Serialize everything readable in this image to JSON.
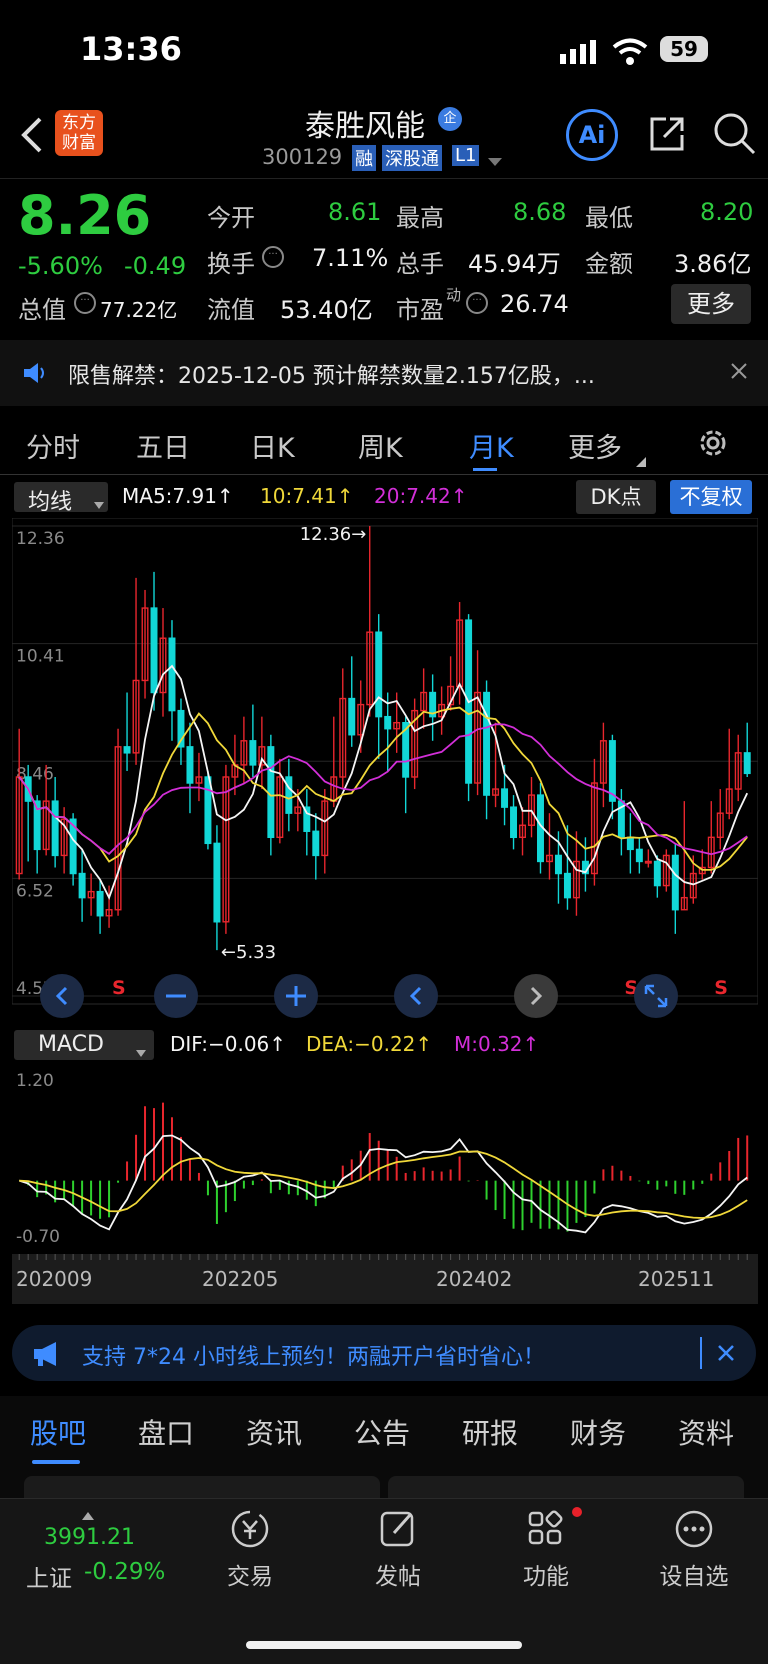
{
  "status_bar": {
    "time": "13:36",
    "battery": "59"
  },
  "header": {
    "logo_line1": "东方",
    "logo_line2": "财富",
    "stock_name": "泰胜风能",
    "badge": "企",
    "code": "300129",
    "tags": [
      "融",
      "深股通",
      "L1"
    ],
    "ai_label": "Ai"
  },
  "quote": {
    "price": "8.26",
    "change_pct": "-5.60%",
    "change_abs": "-0.49",
    "open_label": "今开",
    "open": "8.61",
    "high_label": "最高",
    "high": "8.68",
    "low_label": "最低",
    "low": "8.20",
    "turnover_label": "换手",
    "turnover": "7.11%",
    "volume_label": "总手",
    "volume": "45.94万",
    "amount_label": "金额",
    "amount": "3.86亿",
    "mktcap_label": "总值",
    "mktcap": "77.22亿",
    "float_label": "流值",
    "float": "53.40亿",
    "pe_label": "市盈",
    "pe_sup": "动",
    "pe": "26.74",
    "more_button": "更多"
  },
  "notice": {
    "text": "限售解禁：2025-12-05 预计解禁数量2.157亿股，..."
  },
  "chart_tabs": [
    "分时",
    "五日",
    "日K",
    "周K",
    "月K",
    "更多"
  ],
  "active_chart_tab": "月K",
  "ma_bar": {
    "selector": "均线",
    "ma5": "MA5:7.91↑",
    "ma10": "10:7.41↑",
    "ma20": "20:7.42↑",
    "dk_button": "DK点",
    "adjust_button": "不复权"
  },
  "macd_bar": {
    "selector": "MACD",
    "dif": "DIF:−0.06↑",
    "dea": "DEA:−0.22↑",
    "m": "M:0.32↑"
  },
  "chart_data": [
    {
      "type": "candlestick",
      "title": "月K",
      "y_ticks": [
        "12.36",
        "10.41",
        "8.46",
        "6.52",
        "4.57"
      ],
      "ylim": [
        4.57,
        12.36
      ],
      "annotations": {
        "max": "12.36→",
        "min": "←5.33"
      },
      "signals": [
        "S",
        "S",
        "S",
        "S"
      ],
      "x_labels": [
        "202009",
        "202205",
        "202402",
        "202511"
      ],
      "candles": [
        [
          6.6,
          8.2,
          9.0,
          6.5
        ],
        [
          8.2,
          7.8,
          8.4,
          6.8
        ],
        [
          7.8,
          7.0,
          7.9,
          6.6
        ],
        [
          7.0,
          7.8,
          8.4,
          6.9
        ],
        [
          7.8,
          6.9,
          8.2,
          6.7
        ],
        [
          6.9,
          7.5,
          7.7,
          6.6
        ],
        [
          7.5,
          6.6,
          7.6,
          6.4
        ],
        [
          6.6,
          6.2,
          7.0,
          5.8
        ],
        [
          6.2,
          6.3,
          6.6,
          5.9
        ],
        [
          6.3,
          5.9,
          6.5,
          5.6
        ],
        [
          5.9,
          6.0,
          6.4,
          5.7
        ],
        [
          6.0,
          8.7,
          9.0,
          5.9
        ],
        [
          8.7,
          8.6,
          9.6,
          8.3
        ],
        [
          8.6,
          9.8,
          11.5,
          8.4
        ],
        [
          9.8,
          11.0,
          11.3,
          9.5
        ],
        [
          11.0,
          9.6,
          11.6,
          9.3
        ],
        [
          9.6,
          10.5,
          11.0,
          9.2
        ],
        [
          10.5,
          9.3,
          10.8,
          8.8
        ],
        [
          9.3,
          8.7,
          9.5,
          8.4
        ],
        [
          8.7,
          8.1,
          9.1,
          7.6
        ],
        [
          8.1,
          8.2,
          8.6,
          7.8
        ],
        [
          8.2,
          7.1,
          8.3,
          7.0
        ],
        [
          7.1,
          5.8,
          7.4,
          5.33
        ],
        [
          5.8,
          8.2,
          8.4,
          5.6
        ],
        [
          8.2,
          8.4,
          8.9,
          7.9
        ],
        [
          8.4,
          8.8,
          9.2,
          8.1
        ],
        [
          8.8,
          8.4,
          9.4,
          8.2
        ],
        [
          8.4,
          8.7,
          9.2,
          8.0
        ],
        [
          8.7,
          7.2,
          8.9,
          6.9
        ],
        [
          7.2,
          8.2,
          8.5,
          7.1
        ],
        [
          8.2,
          7.6,
          8.5,
          7.3
        ],
        [
          7.6,
          7.7,
          8.0,
          7.3
        ],
        [
          7.7,
          7.3,
          8.0,
          6.9
        ],
        [
          7.3,
          6.9,
          7.6,
          6.5
        ],
        [
          6.9,
          7.8,
          8.0,
          6.6
        ],
        [
          7.8,
          8.2,
          9.2,
          7.7
        ],
        [
          8.2,
          9.5,
          10.0,
          8.0
        ],
        [
          9.5,
          8.9,
          10.2,
          8.7
        ],
        [
          8.9,
          9.4,
          9.8,
          8.6
        ],
        [
          9.4,
          10.6,
          12.36,
          9.2
        ],
        [
          10.6,
          9.2,
          10.9,
          8.5
        ],
        [
          9.2,
          9.0,
          9.6,
          8.3
        ],
        [
          9.0,
          9.1,
          9.6,
          8.6
        ],
        [
          9.1,
          8.2,
          9.2,
          7.6
        ],
        [
          8.2,
          9.3,
          9.5,
          8.0
        ],
        [
          9.3,
          9.6,
          10.0,
          9.0
        ],
        [
          9.6,
          9.2,
          9.9,
          8.8
        ],
        [
          9.2,
          9.4,
          9.7,
          8.9
        ],
        [
          9.4,
          9.7,
          10.2,
          9.3
        ],
        [
          9.7,
          10.8,
          11.1,
          9.4
        ],
        [
          10.8,
          8.1,
          10.9,
          7.8
        ],
        [
          8.1,
          9.6,
          10.3,
          7.9
        ],
        [
          9.6,
          7.9,
          9.8,
          7.5
        ],
        [
          7.9,
          8.0,
          9.1,
          7.7
        ],
        [
          8.0,
          7.7,
          8.4,
          7.4
        ],
        [
          7.7,
          7.2,
          7.9,
          7.0
        ],
        [
          7.2,
          7.4,
          7.7,
          6.9
        ],
        [
          7.4,
          7.9,
          8.2,
          7.2
        ],
        [
          7.9,
          6.8,
          8.1,
          6.6
        ],
        [
          6.8,
          6.9,
          7.6,
          6.5
        ],
        [
          6.9,
          6.6,
          7.3,
          6.1
        ],
        [
          6.6,
          6.2,
          7.4,
          6.0
        ],
        [
          6.2,
          6.8,
          7.3,
          5.9
        ],
        [
          6.8,
          6.6,
          7.2,
          6.3
        ],
        [
          6.6,
          8.1,
          8.5,
          6.4
        ],
        [
          8.1,
          8.8,
          9.1,
          7.7
        ],
        [
          8.8,
          7.8,
          8.9,
          7.5
        ],
        [
          7.8,
          7.2,
          8.0,
          6.9
        ],
        [
          7.2,
          7.0,
          7.6,
          6.6
        ],
        [
          7.0,
          6.8,
          7.2,
          6.6
        ],
        [
          6.8,
          6.8,
          7.0,
          6.7
        ],
        [
          6.8,
          6.4,
          6.9,
          6.2
        ],
        [
          6.4,
          6.9,
          7.0,
          6.3
        ],
        [
          6.9,
          6.0,
          7.1,
          5.6
        ],
        [
          6.0,
          6.2,
          7.8,
          6.0
        ],
        [
          6.2,
          6.6,
          6.9,
          6.1
        ],
        [
          6.6,
          6.7,
          7.0,
          6.5
        ],
        [
          6.7,
          7.2,
          7.8,
          6.6
        ],
        [
          7.2,
          7.6,
          8.0,
          7.0
        ],
        [
          7.6,
          8.0,
          9.0,
          7.5
        ],
        [
          8.0,
          8.6,
          8.9,
          7.8
        ],
        [
          8.6,
          8.26,
          9.1,
          8.2
        ]
      ]
    },
    {
      "type": "macd",
      "y_ticks": [
        "1.20",
        "-0.70"
      ],
      "ylim": [
        -0.7,
        1.2
      ]
    }
  ],
  "banner": {
    "text": "支持 7*24 小时线上预约！两融开户省时省心！"
  },
  "bottom_tabs": [
    "股吧",
    "盘口",
    "资讯",
    "公告",
    "研报",
    "财务",
    "资料"
  ],
  "active_bottom_tab": "股吧",
  "bottom_nav": {
    "index_value": "3991.21",
    "index_name": "上证",
    "index_change": "-0.29%",
    "items": [
      "交易",
      "发帖",
      "功能",
      "设自选"
    ]
  }
}
